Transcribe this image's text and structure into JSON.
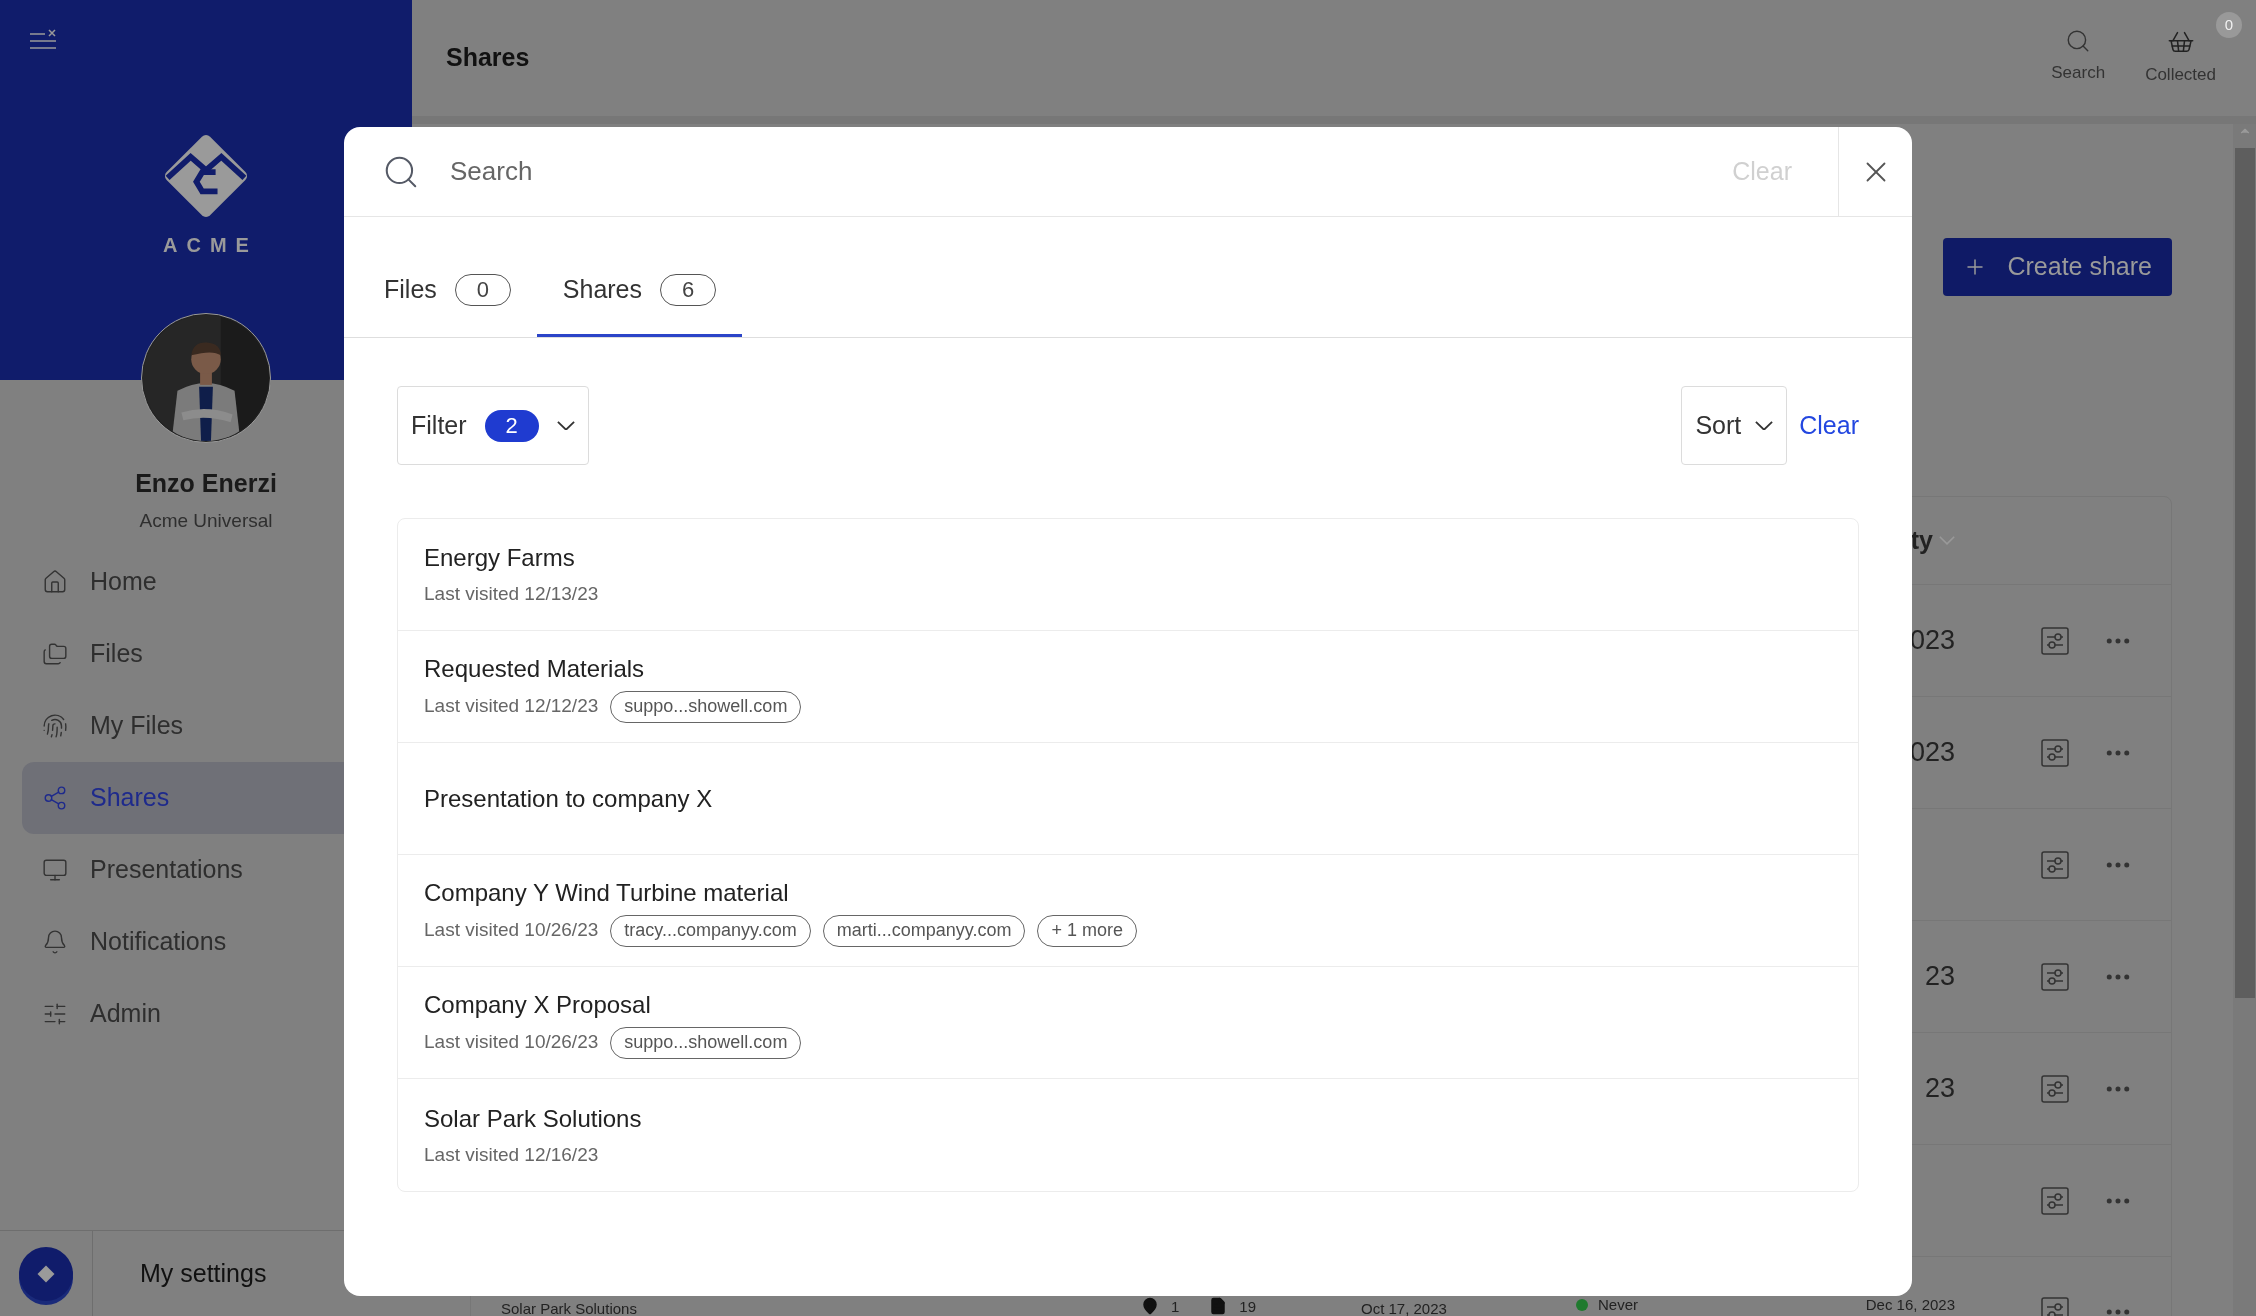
{
  "sidebar": {
    "logo_text": "ACME",
    "user": {
      "name": "Enzo Enerzi",
      "company": "Acme Universal"
    },
    "nav": [
      {
        "label": "Home",
        "selected": false
      },
      {
        "label": "Files",
        "selected": false
      },
      {
        "label": "My Files",
        "selected": false
      },
      {
        "label": "Shares",
        "selected": true
      },
      {
        "label": "Presentations",
        "selected": false
      },
      {
        "label": "Notifications",
        "selected": false
      },
      {
        "label": "Admin",
        "selected": false
      }
    ],
    "settings_label": "My settings"
  },
  "header": {
    "title": "Shares",
    "actions": [
      {
        "label": "Search",
        "kind": "search"
      },
      {
        "label": "Collected",
        "kind": "basket",
        "badge": "0"
      }
    ]
  },
  "page": {
    "create_button": "Create share",
    "table": {
      "column_header": "ty",
      "rows": [
        {
          "date": "023"
        },
        {
          "date": "023"
        },
        {},
        {
          "date": "23"
        },
        {
          "date": "23"
        },
        {},
        {
          "name": "Solar Park Solutions",
          "count_1": "1",
          "count_2": "19",
          "column_3": "Oct 17, 2023",
          "status": "Never",
          "color": "#1f7a2e",
          "date": "Dec 16, 2023"
        }
      ]
    }
  },
  "search_dialog": {
    "placeholder": "Search",
    "clear": "Clear",
    "tabs": [
      {
        "label": "Files",
        "count": "0",
        "selected": false
      },
      {
        "label": "Shares",
        "count": "6",
        "selected": true
      }
    ],
    "filter": {
      "label": "Filter",
      "count": "2"
    },
    "sort": "Sort",
    "clear_filters": "Clear",
    "results": [
      {
        "title": "Energy Farms",
        "subtitle": "Last visited 12/13/23"
      },
      {
        "title": "Requested Materials",
        "subtitle": "Last visited 12/12/23",
        "tags": [
          "suppo...showell.com"
        ]
      },
      {
        "title": "Presentation to company X"
      },
      {
        "title": "Company Y Wind Turbine material",
        "subtitle": "Last visited 10/26/23",
        "tags": [
          "tracy...companyy.com",
          "marti...companyy.com",
          "+ 1 more"
        ]
      },
      {
        "title": "Company X Proposal",
        "subtitle": "Last visited 10/26/23",
        "tags": [
          "suppo...showell.com"
        ]
      },
      {
        "title": "Solar Park Solutions",
        "subtitle": "Last visited 12/16/23"
      }
    ]
  }
}
